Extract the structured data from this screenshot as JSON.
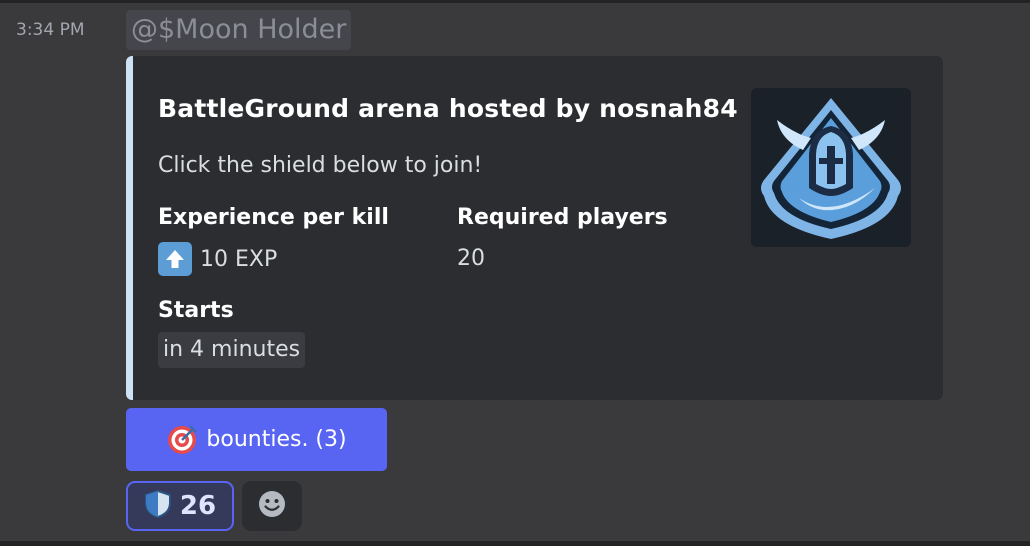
{
  "message": {
    "timestamp": "3:34 PM",
    "mention": "@$Moon Holder"
  },
  "embed": {
    "accent_color": "#cde2f5",
    "title": "BattleGround arena hosted by nosnah84",
    "description": "Click the shield below to join!",
    "fields": [
      {
        "name": "Experience per kill",
        "value": "10 EXP",
        "icon": "up-arrow-icon"
      },
      {
        "name": "Required players",
        "value": "20"
      },
      {
        "name": "Starts",
        "value": "in 4 minutes"
      }
    ],
    "thumbnail": "spartan-helmet-logo"
  },
  "button": {
    "label": "bounties. (3)",
    "icon": "target-icon",
    "color": "#5865f2"
  },
  "reactions": [
    {
      "emoji": "shield-icon",
      "count": "26",
      "active": true
    }
  ],
  "add_reaction": {
    "icon": "smiley-icon"
  }
}
